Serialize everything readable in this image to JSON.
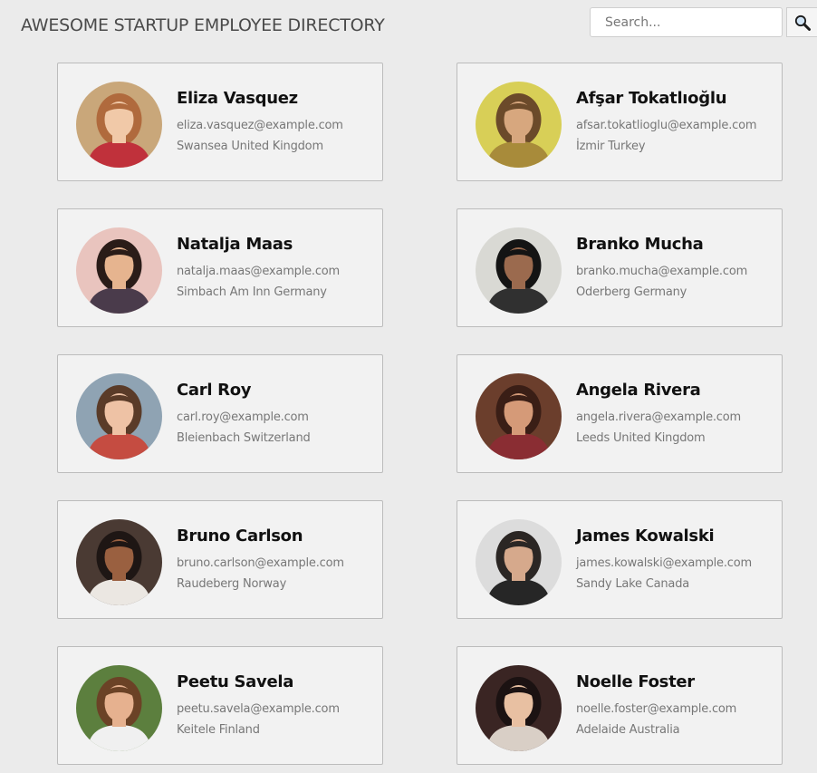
{
  "header": {
    "title": "AWESOME STARTUP EMPLOYEE DIRECTORY"
  },
  "search": {
    "placeholder": "Search...",
    "value": "",
    "button_icon": "search-icon"
  },
  "employees": [
    {
      "name": "Eliza Vasquez",
      "email": "eliza.vasquez@example.com",
      "location": "Swansea United Kingdom",
      "avatar": {
        "bg": "#c9a77a",
        "hair": "#b06a3d",
        "skin": "#f1c9a8",
        "shirt": "#c0313b"
      }
    },
    {
      "name": "Afşar Tokatlıoğlu",
      "email": "afsar.tokatlioglu@example.com",
      "location": "İzmir Turkey",
      "avatar": {
        "bg": "#d8cf57",
        "hair": "#6b4a2a",
        "skin": "#d7a77e",
        "shirt": "#a88b3a"
      }
    },
    {
      "name": "Natalja Maas",
      "email": "natalja.maas@example.com",
      "location": "Simbach Am Inn Germany",
      "avatar": {
        "bg": "#e9c4be",
        "hair": "#2a1c18",
        "skin": "#e6b48f",
        "shirt": "#4a3b4b"
      }
    },
    {
      "name": "Branko Mucha",
      "email": "branko.mucha@example.com",
      "location": "Oderberg Germany",
      "avatar": {
        "bg": "#d9d9d4",
        "hair": "#141414",
        "skin": "#9b6a4e",
        "shirt": "#303030"
      }
    },
    {
      "name": "Carl Roy",
      "email": "carl.roy@example.com",
      "location": "Bleienbach Switzerland",
      "avatar": {
        "bg": "#8fa3b3",
        "hair": "#5a3b28",
        "skin": "#eec2a5",
        "shirt": "#c54c41"
      }
    },
    {
      "name": "Angela Rivera",
      "email": "angela.rivera@example.com",
      "location": "Leeds United Kingdom",
      "avatar": {
        "bg": "#6b3e2c",
        "hair": "#3a1e16",
        "skin": "#d59a78",
        "shirt": "#8a2d33"
      }
    },
    {
      "name": "Bruno Carlson",
      "email": "bruno.carlson@example.com",
      "location": "Raudeberg Norway",
      "avatar": {
        "bg": "#4a3a33",
        "hair": "#1e1614",
        "skin": "#9a6040",
        "shirt": "#ebe7e2"
      }
    },
    {
      "name": "James Kowalski",
      "email": "james.kowalski@example.com",
      "location": "Sandy Lake Canada",
      "avatar": {
        "bg": "#dcdcdc",
        "hair": "#2b2624",
        "skin": "#d6a98c",
        "shirt": "#262626"
      }
    },
    {
      "name": "Peetu Savela",
      "email": "peetu.savela@example.com",
      "location": "Keitele Finland",
      "avatar": {
        "bg": "#5c7f3e",
        "hair": "#6b4226",
        "skin": "#e6b18f",
        "shirt": "#f0f0f0"
      }
    },
    {
      "name": "Noelle Foster",
      "email": "noelle.foster@example.com",
      "location": "Adelaide Australia",
      "avatar": {
        "bg": "#3a2523",
        "hair": "#1b1212",
        "skin": "#e8c0a2",
        "shirt": "#d9cfc6"
      }
    }
  ]
}
